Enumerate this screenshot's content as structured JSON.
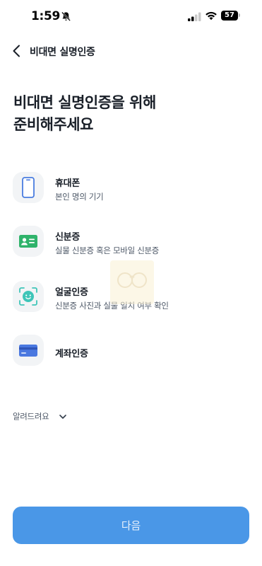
{
  "status_bar": {
    "time": "1:59",
    "battery": "57",
    "icons": [
      "bell-off-icon",
      "signal-icon",
      "wifi-icon",
      "battery-icon"
    ]
  },
  "header": {
    "title": "비대면 실명인증",
    "back_icon": "chevron-left-icon"
  },
  "heading": {
    "line1": "비대면 실명인증을 위해",
    "line2": "준비해주세요"
  },
  "requirements": [
    {
      "title": "휴대폰",
      "description": "본인 명의 기기",
      "icon": "phone-icon"
    },
    {
      "title": "신분증",
      "description": "실물 신분증 혹은 모바일 신분증",
      "icon": "id-card-icon"
    },
    {
      "title": "얼굴인증",
      "description": "신분증 사진과 실물 일치 여부 확인",
      "icon": "face-scan-icon"
    },
    {
      "title": "계좌인증",
      "icon": "bank-card-icon"
    }
  ],
  "info_toggle": {
    "label": "알려드려요",
    "icon": "chevron-down-icon"
  },
  "cta": {
    "label": "다음"
  },
  "colors": {
    "primary": "#4a97e7",
    "title_text": "#191f28",
    "sub_text": "#4e5968",
    "icon_bg": "#f2f4f6",
    "phone_stroke": "#4a7de0",
    "id_card": "#2fb36b",
    "face_frame": "#3ec5b8",
    "bank_card": "#4a78e0"
  }
}
